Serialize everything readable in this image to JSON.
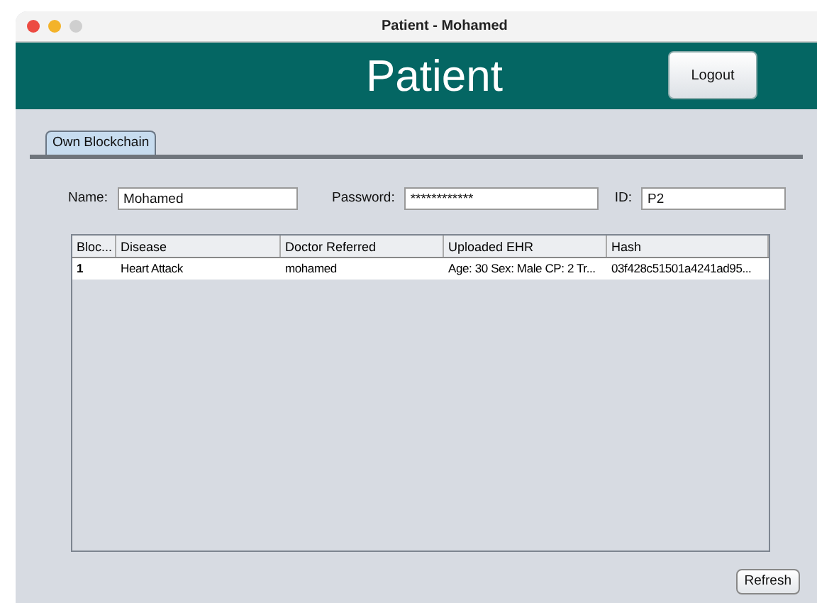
{
  "window": {
    "title": "Patient - Mohamed"
  },
  "header": {
    "title": "Patient",
    "logout": "Logout"
  },
  "tabs": [
    {
      "label": "Own Blockchain",
      "selected": true
    }
  ],
  "fields": [
    {
      "label": "Name:",
      "value": "Mohamed"
    },
    {
      "label": "Password:",
      "value": "************"
    },
    {
      "label": "ID:",
      "value": "P2"
    }
  ],
  "table": {
    "columns": [
      "Bloc...",
      "Disease",
      "Doctor Referred",
      "Uploaded EHR",
      "Hash"
    ],
    "rows": [
      [
        "1",
        "Heart Attack",
        "mohamed",
        "Age: 30 Sex: Male CP: 2 Tr...",
        "03f428c51501a4241ad95..."
      ]
    ]
  },
  "refresh": "Refresh"
}
